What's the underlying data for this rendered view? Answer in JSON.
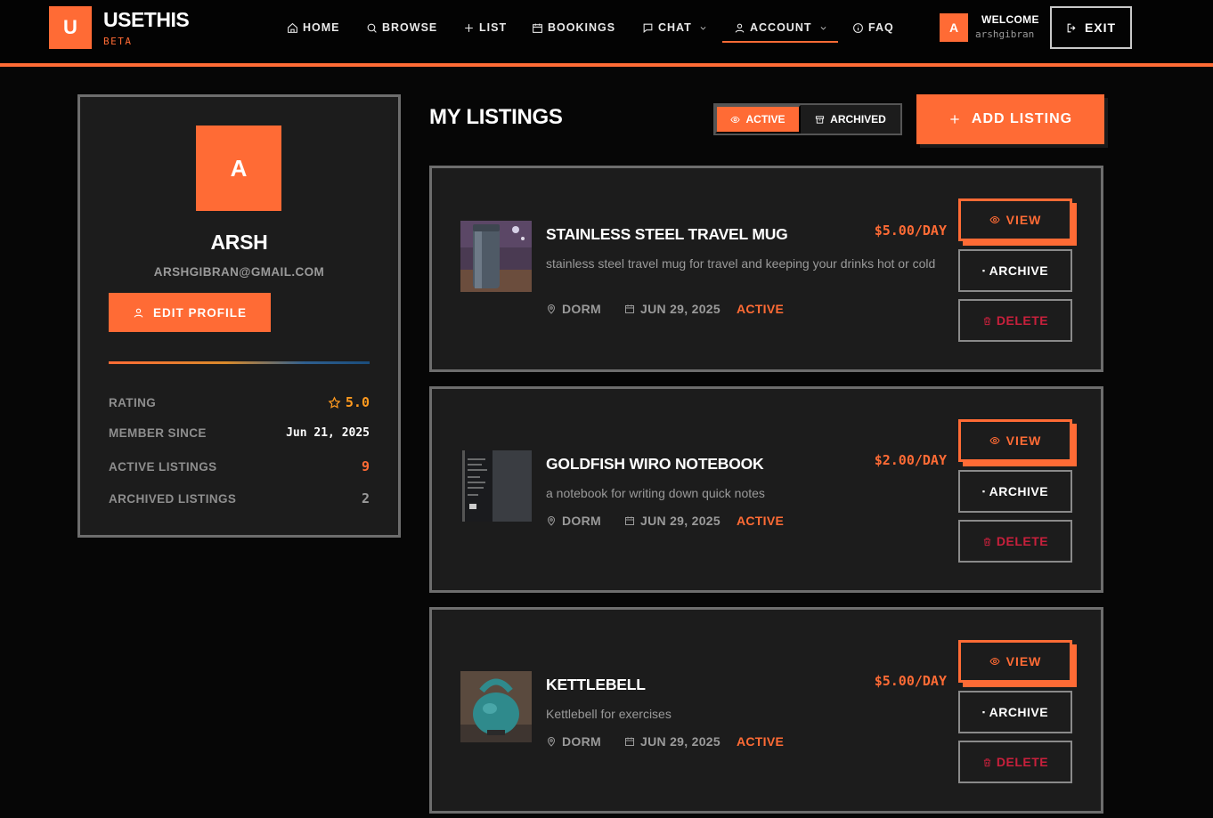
{
  "brand": {
    "logo_letter": "U",
    "name": "USETHIS",
    "tag": "BETA",
    "accent": "#ff6b35"
  },
  "nav": {
    "home": "HOME",
    "browse": "BROWSE",
    "list": "LIST",
    "bookings": "BOOKINGS",
    "chat": "CHAT",
    "account": "ACCOUNT",
    "faq": "FAQ",
    "icons": {
      "home": "home-icon",
      "browse": "search-icon",
      "list": "plus-icon",
      "bookings": "calendar-icon",
      "chat": "chat-bubble-icon",
      "account": "user-icon",
      "faq": "info-icon"
    }
  },
  "user": {
    "avatar_letter": "A",
    "welcome": "WELCOME",
    "username": "arshgibran",
    "exit": "EXIT"
  },
  "profile": {
    "avatar_letter": "A",
    "name": "ARSH",
    "email": "ARSHGIBRAN@GMAIL.COM",
    "edit_label": "EDIT PROFILE",
    "stats": {
      "rating_label": "RATING",
      "rating_value": "5.0",
      "member_label": "MEMBER SINCE",
      "member_value": "Jun 21, 2025",
      "active_label": "ACTIVE LISTINGS",
      "active_value": "9",
      "archived_label": "ARCHIVED LISTINGS",
      "archived_value": "2"
    }
  },
  "listings_header": {
    "title": "MY LISTINGS",
    "filter_active": "ACTIVE",
    "filter_archived": "ARCHIVED",
    "add_label": "ADD LISTING"
  },
  "listings": [
    {
      "title": "STAINLESS STEEL TRAVEL MUG",
      "description": "stainless steel travel mug for travel and keeping your drinks hot or cold",
      "price": "$5.00/DAY",
      "location": "DORM",
      "date": "JUN 29, 2025",
      "status": "ACTIVE",
      "view": "VIEW",
      "archive": "ARCHIVE",
      "delete": "DELETE"
    },
    {
      "title": "GOLDFISH WIRO NOTEBOOK",
      "description": "a notebook for writing down quick notes",
      "price": "$2.00/DAY",
      "location": "DORM",
      "date": "JUN 29, 2025",
      "status": "ACTIVE",
      "view": "VIEW",
      "archive": "ARCHIVE",
      "delete": "DELETE"
    },
    {
      "title": "KETTLEBELL",
      "description": "Kettlebell for exercises",
      "price": "$5.00/DAY",
      "location": "DORM",
      "date": "JUN 29, 2025",
      "status": "ACTIVE",
      "view": "VIEW",
      "archive": "ARCHIVE",
      "delete": "DELETE"
    }
  ]
}
